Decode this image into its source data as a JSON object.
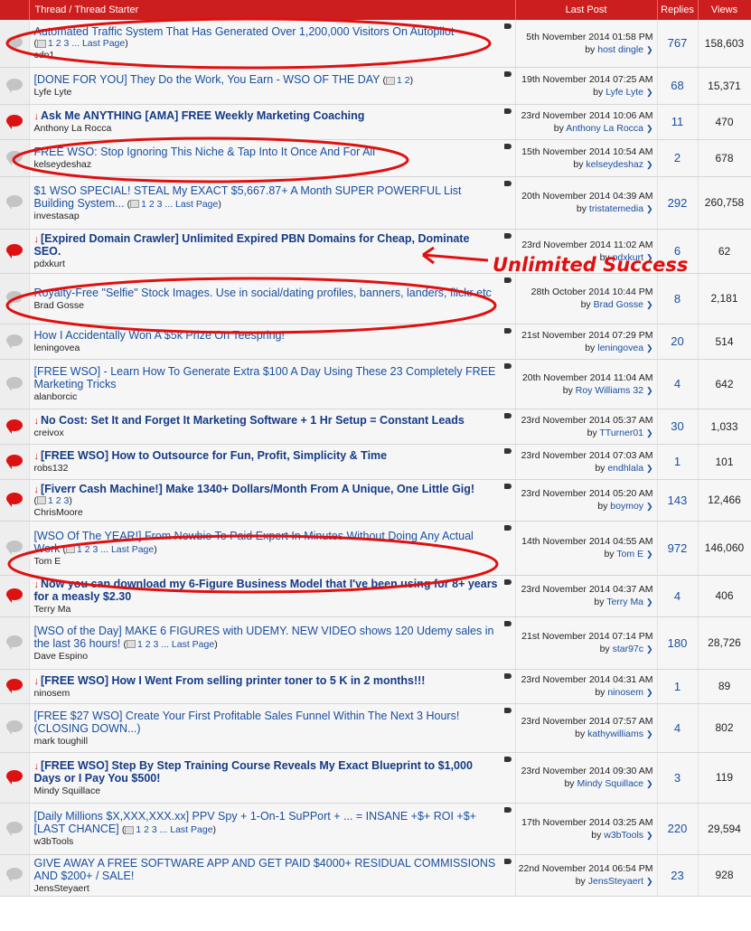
{
  "header": {
    "col_thread": "Thread / Thread Starter",
    "col_last": "Last Post",
    "col_replies": "Replies",
    "col_views": "Views"
  },
  "annotation": {
    "text": "Unlimited Success",
    "color": "#e01010"
  },
  "colors": {
    "header_bg": "#cc1e1e",
    "link": "#1a4fa0",
    "hot_icon": "#d11111"
  },
  "threads": [
    {
      "icon": "grey",
      "title": "Automated Traffic System That Has Generated Over 1,200,000 Visitors On Autopilot",
      "bold": false,
      "arrow": false,
      "pages": "1 2 3 ... Last Page",
      "starter": "cdn1",
      "date": "5th November 2014 01:58 PM",
      "by": "host dingle",
      "replies": "767",
      "views": "158,603"
    },
    {
      "icon": "grey",
      "title": "[DONE FOR YOU] They Do the Work, You Earn - WSO OF THE DAY",
      "bold": false,
      "arrow": false,
      "pages_inline": "1 2",
      "starter": "Lyfe Lyte",
      "date": "19th November 2014 07:25 AM",
      "by": "Lyfe Lyte",
      "replies": "68",
      "views": "15,371"
    },
    {
      "icon": "red",
      "title": "Ask Me ANYTHING [AMA] FREE Weekly Marketing Coaching",
      "bold": true,
      "arrow": true,
      "starter": "Anthony La Rocca",
      "date": "23rd November 2014 10:06 AM",
      "by": "Anthony La Rocca",
      "replies": "11",
      "views": "470"
    },
    {
      "icon": "grey",
      "title": "FREE WSO: Stop Ignoring This Niche & Tap Into It Once And For All",
      "bold": false,
      "arrow": false,
      "starter": "kelseydeshaz",
      "date": "15th November 2014 10:54 AM",
      "by": "kelseydeshaz",
      "replies": "2",
      "views": "678"
    },
    {
      "icon": "grey",
      "title": "$1 WSO SPECIAL! STEAL My EXACT $5,667.87+ A Month SUPER POWERFUL List Building System...",
      "bold": false,
      "arrow": false,
      "pages_inline": "1 2 3 ... Last Page",
      "starter": "investasap",
      "date": "20th November 2014 04:39 AM",
      "by": "tristatemedia",
      "replies": "292",
      "views": "260,758"
    },
    {
      "icon": "red",
      "title": "[Expired Domain Crawler] Unlimited Expired PBN Domains for Cheap, Dominate SEO.",
      "bold": true,
      "arrow": true,
      "starter": "pdxkurt",
      "date": "23rd November 2014 11:02 AM",
      "by": "pdxkurt",
      "replies": "6",
      "views": "62"
    },
    {
      "icon": "grey",
      "title": "Royalty-Free \"Selfie\" Stock Images. Use in social/dating profiles, banners, landers, flickr etc",
      "bold": false,
      "arrow": false,
      "starter": "Brad Gosse",
      "date": "28th October 2014 10:44 PM",
      "by": "Brad Gosse",
      "replies": "8",
      "views": "2,181"
    },
    {
      "icon": "grey",
      "title": "How I Accidentally Won A $5k Prize On Teespring!",
      "bold": false,
      "arrow": false,
      "starter": "leningovea",
      "date": "21st November 2014 07:29 PM",
      "by": "leningovea",
      "replies": "20",
      "views": "514"
    },
    {
      "icon": "grey",
      "title": "[FREE WSO] - Learn How To Generate Extra $100 A Day Using These 23 Completely FREE Marketing Tricks",
      "bold": false,
      "arrow": false,
      "starter": "alanborcic",
      "date": "20th November 2014 11:04 AM",
      "by": "Roy Williams 32",
      "replies": "4",
      "views": "642"
    },
    {
      "icon": "red",
      "title": "No Cost: Set It and Forget It Marketing Software + 1 Hr Setup = Constant Leads",
      "bold": true,
      "arrow": true,
      "starter": "creivox",
      "date": "23rd November 2014 05:37 AM",
      "by": "TTurner01",
      "replies": "30",
      "views": "1,033"
    },
    {
      "icon": "red",
      "title": "[FREE WSO] How to Outsource for Fun, Profit, Simplicity & Time",
      "bold": true,
      "arrow": true,
      "starter": "robs132",
      "date": "23rd November 2014 07:03 AM",
      "by": "endhlala",
      "replies": "1",
      "views": "101"
    },
    {
      "icon": "red",
      "title": "[Fiverr Cash Machine!] Make 1340+ Dollars/Month From A Unique, One Little Gig!",
      "bold": true,
      "arrow": true,
      "pages": "1 2 3",
      "starter": "ChrisMoore",
      "date": "23rd November 2014 05:20 AM",
      "by": "boymoy",
      "replies": "143",
      "views": "12,466"
    },
    {
      "icon": "grey",
      "title": "[WSO Of The YEAR!] From Newbie To Paid Expert In Minutes Without Doing Any Actual Work",
      "bold": false,
      "arrow": false,
      "pages_inline": "1 2 3 ... Last Page",
      "starter": "Tom E",
      "date": "14th November 2014 04:55 AM",
      "by": "Tom E",
      "replies": "972",
      "views": "146,060"
    },
    {
      "icon": "red",
      "title": "Now you can download my 6-Figure Business Model that I've been using for 8+ years for a measly $2.30",
      "bold": true,
      "arrow": true,
      "starter": "Terry Ma",
      "date": "23rd November 2014 04:37 AM",
      "by": "Terry Ma",
      "replies": "4",
      "views": "406"
    },
    {
      "icon": "grey",
      "title": "[WSO of the Day] MAKE 6 FIGURES with UDEMY. NEW VIDEO shows 120 Udemy sales in the last 36 hours!",
      "bold": false,
      "arrow": false,
      "pages_inline": "1 2 3 ... Last Page",
      "starter": "Dave Espino",
      "date": "21st November 2014 07:14 PM",
      "by": "star97c",
      "replies": "180",
      "views": "28,726"
    },
    {
      "icon": "red",
      "title": "[FREE WSO] How I Went From selling printer toner to 5 K in 2 months!!!",
      "bold": true,
      "arrow": true,
      "starter": "ninosem",
      "date": "23rd November 2014 04:31 AM",
      "by": "ninosem",
      "replies": "1",
      "views": "89"
    },
    {
      "icon": "grey",
      "title": "[FREE $27 WSO] Create Your First Profitable Sales Funnel Within The Next 3 Hours! (CLOSING DOWN...)",
      "bold": false,
      "arrow": false,
      "starter": "mark toughill",
      "date": "23rd November 2014 07:57 AM",
      "by": "kathywilliams",
      "replies": "4",
      "views": "802"
    },
    {
      "icon": "red",
      "title": "[FREE WSO] Step By Step Training Course Reveals My Exact Blueprint to $1,000 Days or I Pay You $500!",
      "bold": true,
      "arrow": true,
      "starter": "Mindy Squillace",
      "date": "23rd November 2014 09:30 AM",
      "by": "Mindy Squillace",
      "replies": "3",
      "views": "119"
    },
    {
      "icon": "grey",
      "title": "[Daily Millions $X,XXX,XXX.xx] PPV Spy + 1-On-1 SuPPort + ... = INSANE +$+ ROI +$+ [LAST CHANCE]",
      "bold": false,
      "arrow": false,
      "pages_inline": "1 2 3 ... Last Page",
      "starter": "w3bTools",
      "date": "17th November 2014 03:25 AM",
      "by": "w3bTools",
      "replies": "220",
      "views": "29,594"
    },
    {
      "icon": "grey",
      "title": "GIVE AWAY A FREE SOFTWARE APP AND GET PAID $4000+ RESIDUAL COMMISSIONS AND $200+ / SALE!",
      "bold": false,
      "arrow": false,
      "starter": "JensSteyaert",
      "date": "22nd November 2014 06:54 PM",
      "by": "JensSteyaert",
      "replies": "23",
      "views": "928"
    }
  ]
}
